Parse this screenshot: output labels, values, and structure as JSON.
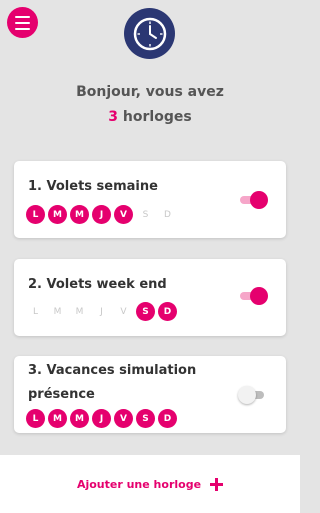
{
  "header": {
    "menu_icon": "hamburger-menu-icon",
    "logo_icon": "clock-icon",
    "greeting_line1": "Bonjour, vous avez",
    "count": "3",
    "greeting_word": "horloges"
  },
  "colors": {
    "accent": "#e5006e",
    "logo_bg": "#2b3773",
    "background": "#e4e4e4"
  },
  "clocks": [
    {
      "title": "1. Volets semaine",
      "enabled": true,
      "days": [
        {
          "label": "L",
          "active": true
        },
        {
          "label": "M",
          "active": true
        },
        {
          "label": "M",
          "active": true
        },
        {
          "label": "J",
          "active": true
        },
        {
          "label": "V",
          "active": true
        },
        {
          "label": "S",
          "active": false
        },
        {
          "label": "D",
          "active": false
        }
      ]
    },
    {
      "title": "2. Volets week end",
      "enabled": true,
      "days": [
        {
          "label": "L",
          "active": false
        },
        {
          "label": "M",
          "active": false
        },
        {
          "label": "M",
          "active": false
        },
        {
          "label": "J",
          "active": false
        },
        {
          "label": "V",
          "active": false
        },
        {
          "label": "S",
          "active": true
        },
        {
          "label": "D",
          "active": true
        }
      ]
    },
    {
      "title_line1": "3. Vacances simulation",
      "title_line2": "présence",
      "enabled": false,
      "days": [
        {
          "label": "L",
          "active": true
        },
        {
          "label": "M",
          "active": true
        },
        {
          "label": "M",
          "active": true
        },
        {
          "label": "J",
          "active": true
        },
        {
          "label": "V",
          "active": true
        },
        {
          "label": "S",
          "active": true
        },
        {
          "label": "D",
          "active": true
        }
      ]
    }
  ],
  "footer": {
    "add_label": "Ajouter une horloge",
    "add_icon": "plus-icon"
  }
}
